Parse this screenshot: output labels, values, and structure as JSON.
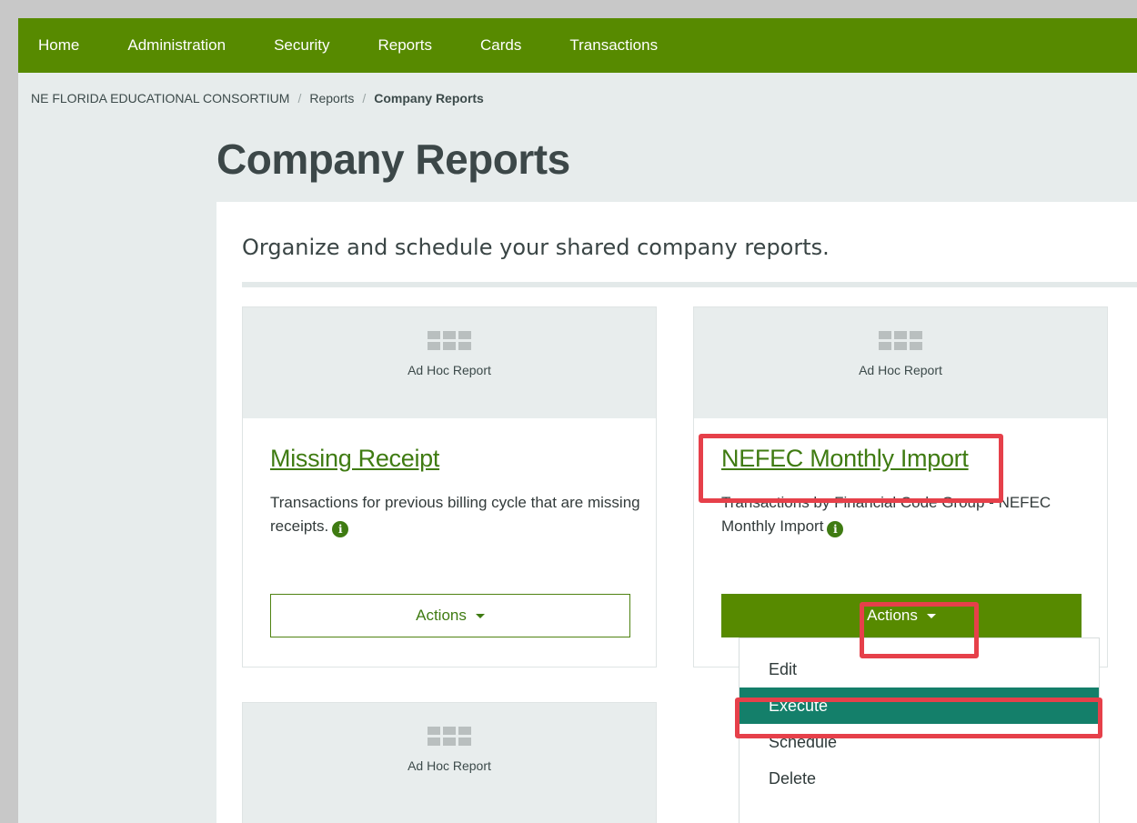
{
  "nav": {
    "items": [
      "Home",
      "Administration",
      "Security",
      "Reports",
      "Cards",
      "Transactions"
    ]
  },
  "breadcrumb": {
    "org": "NE FLORIDA EDUCATIONAL CONSORTIUM",
    "separator": "/",
    "reports": "Reports",
    "current": "Company Reports"
  },
  "page": {
    "title": "Company Reports",
    "subtitle": "Organize and schedule your shared company reports."
  },
  "cards": [
    {
      "type": "Ad Hoc Report",
      "title": "Missing Receipt",
      "description": "Transactions for previous billing cycle that are missing receipts.",
      "actions_label": "Actions"
    },
    {
      "type": "Ad Hoc Report",
      "title": "NEFEC Monthly Import",
      "description": "Transactions by Financial Code Group - NEFEC Monthly Import",
      "actions_label": "Actions"
    },
    {
      "type": "Ad Hoc Report"
    }
  ],
  "actions_menu": {
    "items": [
      "Edit",
      "Execute",
      "Schedule",
      "Delete"
    ],
    "highlighted": "Execute"
  },
  "colors": {
    "nav_bg": "#578a00",
    "link": "#3f7b12",
    "menu_highlight": "#147f6a",
    "annotation": "#e6404a"
  },
  "icons": {
    "info": "i"
  }
}
